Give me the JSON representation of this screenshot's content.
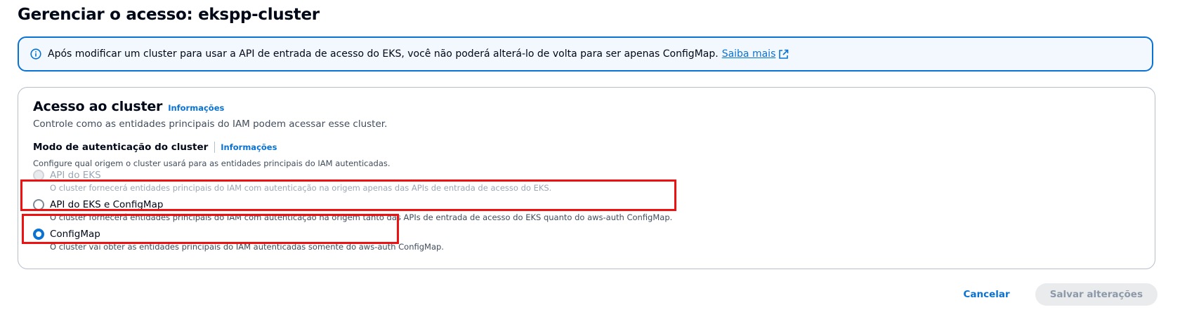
{
  "page": {
    "title": "Gerenciar o acesso: ekspp-cluster"
  },
  "alert": {
    "text": "Após modificar um cluster para usar a API de entrada de acesso do EKS, você não poderá alterá-lo de volta para ser apenas ConfigMap.",
    "link_label": "Saiba mais",
    "icon": "info-icon",
    "link_icon": "external-link-icon"
  },
  "cluster_access": {
    "title": "Acesso ao cluster",
    "info_link": "Informações",
    "description": "Controle como as entidades principais do IAM podem acessar esse cluster.",
    "auth_mode": {
      "label": "Modo de autenticação do cluster",
      "info_link": "Informações",
      "description": "Configure qual origem o cluster usará para as entidades principais do IAM autenticadas.",
      "options": [
        {
          "label": "API do EKS",
          "description": "O cluster fornecerá entidades principais do IAM com autenticação na origem apenas das APIs de entrada de acesso do EKS.",
          "disabled": true,
          "checked": false
        },
        {
          "label": "API do EKS e ConfigMap",
          "description": "O cluster fornecerá entidades principais do IAM com autenticação na origem tanto das APIs de entrada de acesso do EKS quanto do aws-auth ConfigMap.",
          "disabled": false,
          "checked": false
        },
        {
          "label": "ConfigMap",
          "description": "O cluster vai obter as entidades principais do IAM autenticadas somente do aws-auth ConfigMap.",
          "disabled": false,
          "checked": true
        }
      ]
    }
  },
  "footer": {
    "cancel_label": "Cancelar",
    "save_label": "Salvar alterações"
  },
  "colors": {
    "accent": "#0972d3",
    "highlight": "#ee1111",
    "disabled_text": "#9ba7b6"
  }
}
